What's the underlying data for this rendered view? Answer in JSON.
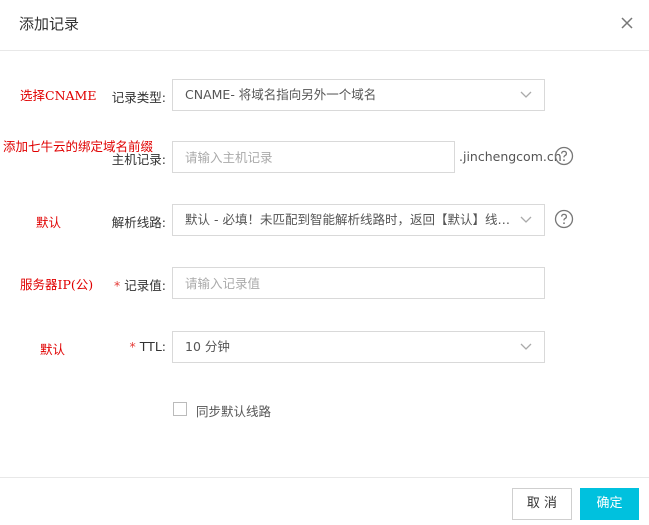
{
  "dialog": {
    "title": "添加记录"
  },
  "annotations": {
    "record_type": "选择CNAME",
    "host": "添加七牛云的绑定域名前缀",
    "line": "默认",
    "value": "服务器IP(公)",
    "ttl": "默认"
  },
  "form": {
    "record_type": {
      "label": "记录类型:",
      "value": "CNAME- 将域名指向另外一个域名"
    },
    "host": {
      "label": "主机记录:",
      "placeholder": "请输入主机记录",
      "suffix": ".jinchengcom.cn"
    },
    "line": {
      "label": "解析线路:",
      "value": "默认 - 必填！未匹配到智能解析线路时，返回【默认】线路..."
    },
    "value": {
      "required_mark": "*",
      "label": "记录值:",
      "placeholder": "请输入记录值"
    },
    "ttl": {
      "required_mark": "*",
      "label": "TTL:",
      "value": "10 分钟"
    },
    "sync": {
      "label": "同步默认线路",
      "checked": false
    }
  },
  "footer": {
    "cancel_label": "取 消",
    "ok_label": "确定"
  },
  "colors": {
    "primary": "#00c1de",
    "annotation": "#e00000",
    "required": "#e53935"
  },
  "icons": {
    "close": "close-icon",
    "chevron": "chevron-down-icon",
    "help": "help-circle-icon"
  }
}
